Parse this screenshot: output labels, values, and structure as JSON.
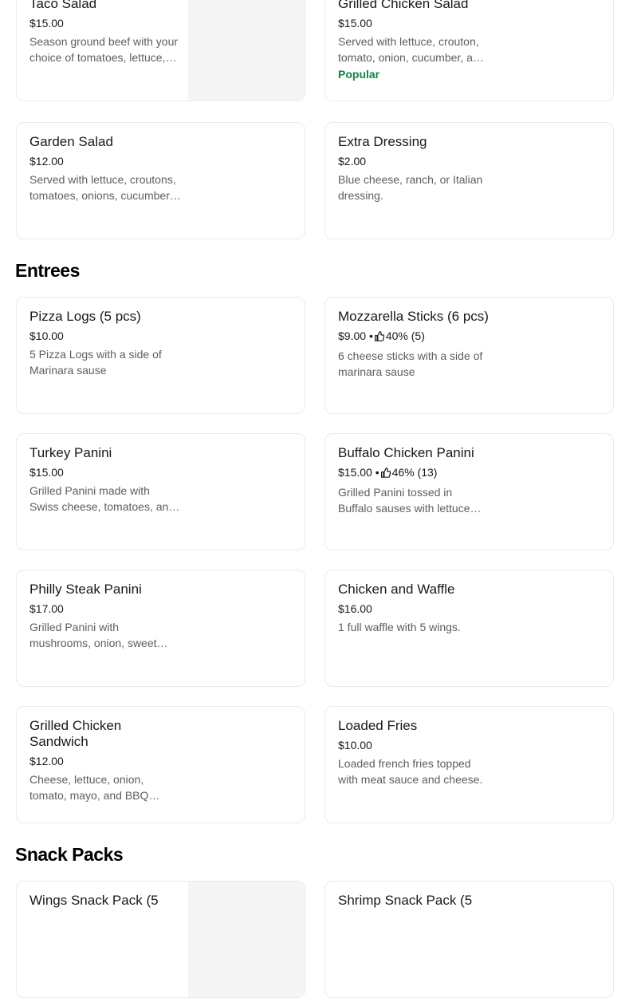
{
  "top_cards": [
    {
      "title": "Taco Salad",
      "price": "$15.00",
      "desc": "Season ground beef with your choice of tomatoes, lettuce, cheese and sour cream."
    },
    {
      "title": "Grilled Chicken Salad",
      "price": "$15.00",
      "desc": "Served with lettuce, crouton, tomato, onion, cucumber, and cheese.",
      "badge": "Popular"
    },
    {
      "title": "Garden Salad",
      "price": "$12.00",
      "desc": "Served with lettuce, croutons, tomatoes, onions, cucumbers, and cheese."
    },
    {
      "title": "Extra Dressing",
      "price": "$2.00",
      "desc": "Blue cheese, ranch, or Italian dressing."
    }
  ],
  "sections": {
    "entrees": "Entrees",
    "snack_packs": "Snack Packs"
  },
  "entrees": [
    {
      "title": "Pizza Logs (5 pcs)",
      "price": "$10.00",
      "desc": "5 Pizza Logs with a side of Marinara sause"
    },
    {
      "title": "Mozzarella Sticks (6 pcs)",
      "price": "$9.00",
      "rating": "40% (5)",
      "desc": "6 cheese sticks with a side of marinara sause"
    },
    {
      "title": "Turkey Panini",
      "price": "$15.00",
      "desc": "Grilled Panini made with Swiss cheese, tomatoes, and turkey."
    },
    {
      "title": "Buffalo Chicken Panini",
      "price": "$15.00",
      "rating": "46% (13)",
      "desc": "Grilled Panini tossed in Buffalo sauses with lettuce and cheese."
    },
    {
      "title": "Philly Steak Panini",
      "price": "$17.00",
      "desc": "Grilled Panini with mushrooms, onion, sweet peppers, and steak."
    },
    {
      "title": "Chicken and Waffle",
      "price": "$16.00",
      "desc": "1 full waffle with 5 wings."
    },
    {
      "title": "Grilled Chicken Sandwich",
      "price": "$12.00",
      "desc": "Cheese, lettuce, onion, tomato, mayo, and BBQ sauce."
    },
    {
      "title": "Loaded Fries",
      "price": "$10.00",
      "desc": "Loaded french fries topped with meat sauce and cheese."
    }
  ],
  "snack_cards": [
    {
      "title": "Wings Snack Pack (5"
    },
    {
      "title": "Shrimp Snack Pack (5"
    }
  ],
  "icons": {
    "rating": "thumbs-up-icon"
  },
  "colors": {
    "popular": "#0e8345",
    "description": "#5e5e5e",
    "border": "#ebebeb"
  }
}
